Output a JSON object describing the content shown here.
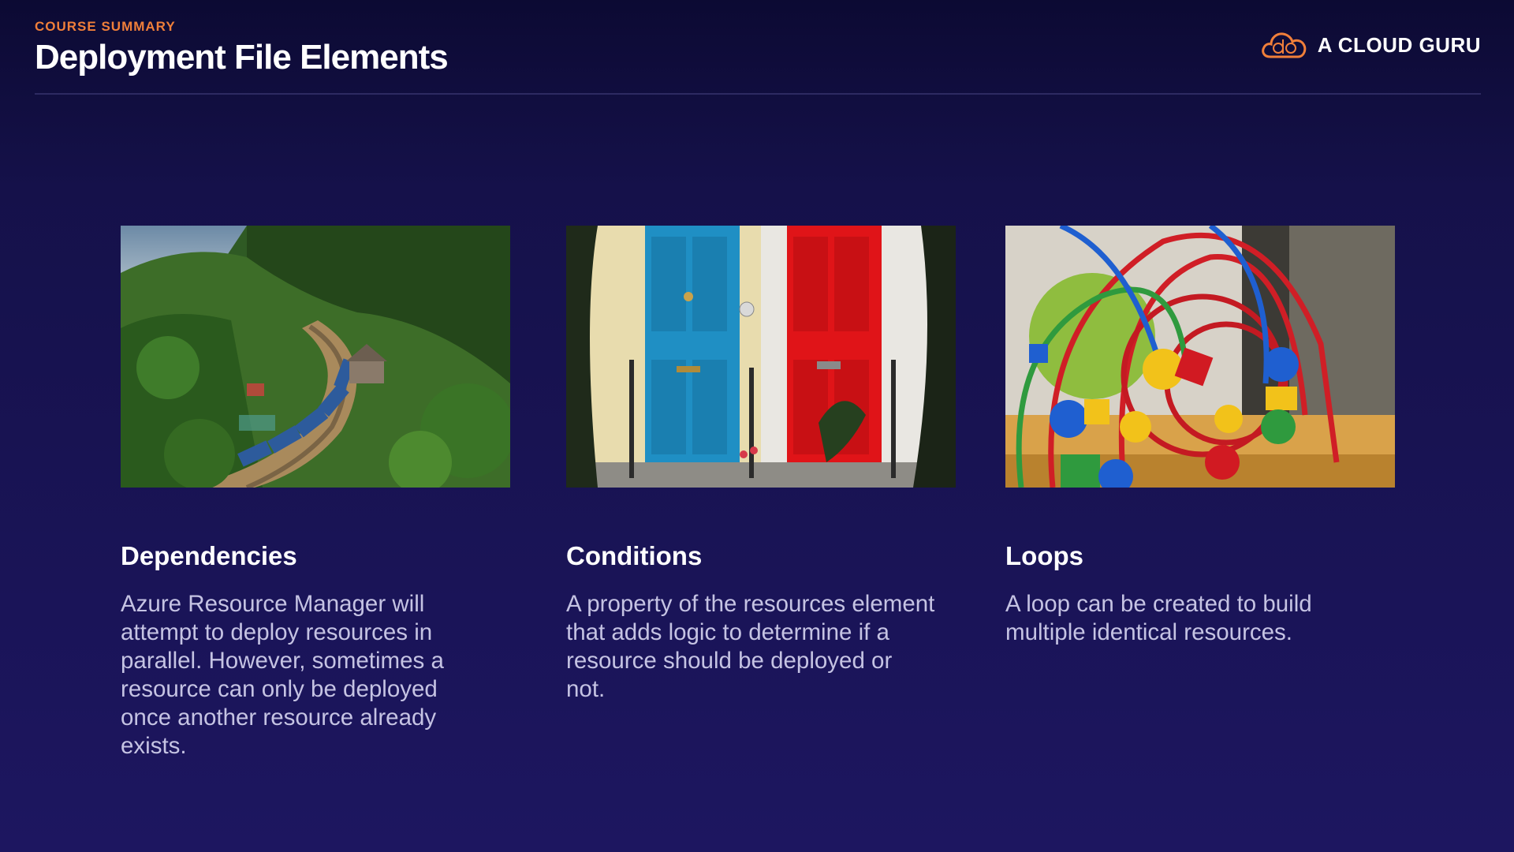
{
  "header": {
    "eyebrow": "COURSE SUMMARY",
    "title": "Deployment File Elements"
  },
  "brand": {
    "logo_icon": "cloud-icon",
    "name": "A CLOUD GURU",
    "accent_color": "#f07f3a"
  },
  "cards": [
    {
      "image": "mountain-train-photo",
      "heading": "Dependencies",
      "body": "Azure Resource Manager will attempt to deploy resources in parallel. However, sometimes a resource can only be deployed once another resource already exists."
    },
    {
      "image": "blue-and-red-doors-photo",
      "heading": "Conditions",
      "body": "A property of the resources element that adds logic to determine if a resource should be deployed or not."
    },
    {
      "image": "bead-maze-toy-photo",
      "heading": "Loops",
      "body": "A loop can be created to build multiple identical resources."
    }
  ]
}
